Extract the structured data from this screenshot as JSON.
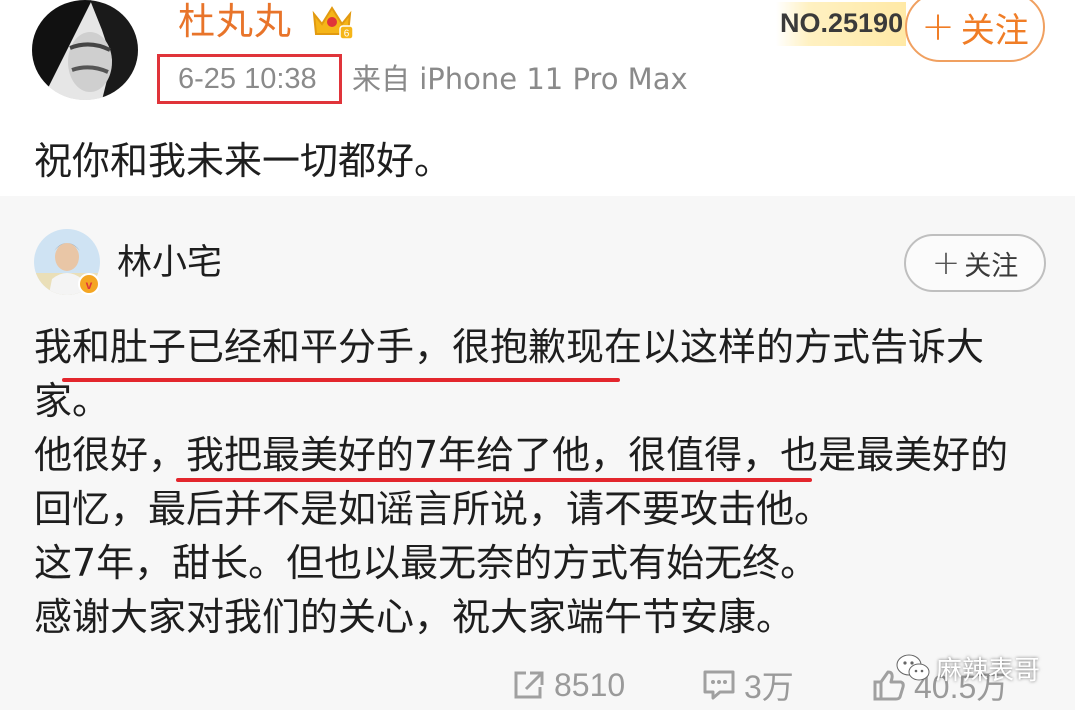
{
  "post": {
    "username": "杜丸丸",
    "rank": "NO.25190",
    "follow_label": "关注",
    "time": "6-25 10:38",
    "source": "来自 iPhone 11 Pro Max",
    "text": "祝你和我未来一切都好。"
  },
  "repost": {
    "username": "林小宅",
    "follow_label": "关注",
    "paragraphs": [
      "我和肚子已经和平分手，很抱歉现在以这样的方式告诉大家。",
      "他很好，我把最美好的7年给了他，很值得，也是最美好的回忆，最后并不是如谣言所说，请不要攻击他。",
      "这7年，甜长。但也以最无奈的方式有始无终。",
      "感谢大家对我们的关心，祝大家端午节安康。"
    ]
  },
  "actions": {
    "repost_count": "8510",
    "comment_count": "3万",
    "like_count": "40.5万"
  },
  "watermark": "麻辣表哥",
  "colors": {
    "username": "#e8742a",
    "follow_main": "#f07d26",
    "highlight_red": "#e0343a",
    "meta_gray": "#8a8a8a",
    "repost_bg": "#f7f7f7"
  }
}
